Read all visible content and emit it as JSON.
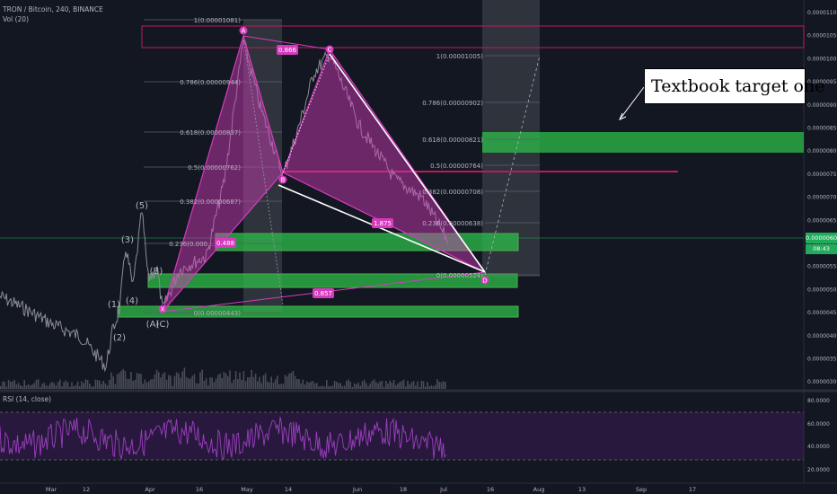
{
  "header": {
    "symbol_line": "TRON / Bitcoin, 240, BINANCE",
    "volume_label": "Vol (20)",
    "rsi_label": "RSI (14, close)"
  },
  "annotation": {
    "callout_text": "Textbook target one"
  },
  "price_axis": {
    "ticks": [
      "0.00001100",
      "0.00001050",
      "0.00001000",
      "0.00000950",
      "0.00000900",
      "0.00000850",
      "0.00000800",
      "0.00000750",
      "0.00000700",
      "0.00000650",
      "0.00000600",
      "0.00000550",
      "0.00000500",
      "0.00000450",
      "0.00000400",
      "0.00000350",
      "0.00000300"
    ],
    "current_price": "0.00000604",
    "current_sub": "08:43"
  },
  "rsi_axis": {
    "ticks": [
      "80.0000",
      "60.0000",
      "40.0000",
      "20.0000"
    ]
  },
  "time_axis": {
    "ticks": [
      "Mar",
      "12",
      "Apr",
      "16",
      "May",
      "14",
      "Jun",
      "18",
      "Jul",
      "16",
      "Aug",
      "13",
      "Sep",
      "17"
    ]
  },
  "fib_left": {
    "levels": [
      "1(0.00001081)",
      "0.786(0.00000944)",
      "0.618(0.00000837)",
      "0.5(0.00000762)",
      "0.382(0.00000687)",
      "0.236(0.000…",
      "0(0.00000443)"
    ]
  },
  "fib_right": {
    "levels": [
      "1(0.00001005)",
      "0.786(0.00000902)",
      "0.618(0.00000821)",
      "0.5(0.00000764)",
      "0.382(0.00000708)",
      "0.236(0.00000638)",
      "0(0.00000524)"
    ]
  },
  "pattern": {
    "points": [
      "X",
      "A",
      "B",
      "C",
      "D"
    ],
    "ratios": [
      "0.866",
      "1.875",
      "0.857",
      "0.488"
    ]
  },
  "elliott": {
    "labels": [
      "(1)",
      "(2)",
      "(3)",
      "(4)",
      "(5)",
      "(A)",
      "(B)",
      "(C)"
    ]
  },
  "colors": {
    "bg": "#131722",
    "green_zone": "#2ebd48",
    "red_zone": "#c2185b",
    "harmonic": "#d63bbd",
    "rsi": "#9b3fbf",
    "price_tag": "#21ac5b"
  }
}
